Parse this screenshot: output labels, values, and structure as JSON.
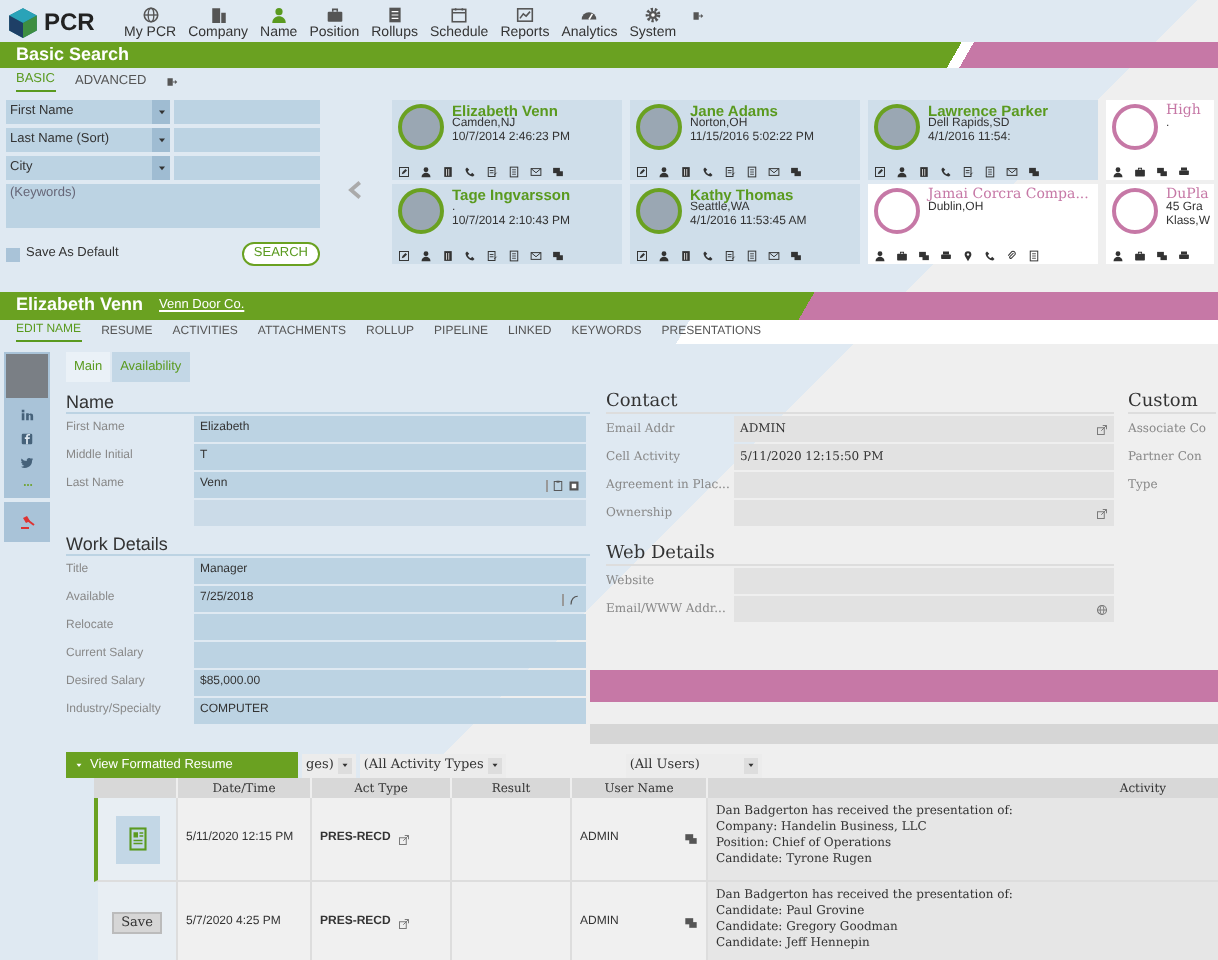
{
  "nav": {
    "logo": "PCR",
    "items": [
      {
        "label": "My PCR",
        "selected": false
      },
      {
        "label": "Company",
        "selected": false
      },
      {
        "label": "Name",
        "selected": true
      },
      {
        "label": "Position",
        "selected": false
      },
      {
        "label": "Rollups",
        "selected": false
      },
      {
        "label": "Schedule",
        "selected": false
      },
      {
        "label": "Reports",
        "selected": false
      },
      {
        "label": "Analytics",
        "selected": false
      },
      {
        "label": "System",
        "selected": false
      }
    ]
  },
  "search": {
    "title": "Basic Search",
    "tabs": [
      {
        "label": "BASIC",
        "selected": true
      },
      {
        "label": "ADVANCED",
        "selected": false
      }
    ],
    "fields": [
      {
        "label": "First Name"
      },
      {
        "label": "Last Name (Sort)"
      },
      {
        "label": "City"
      }
    ],
    "keywords_placeholder": "(Keywords)",
    "save_default": {
      "label": "Save As Default",
      "checked": false
    },
    "button": "SEARCH"
  },
  "results": [
    {
      "kind": "person",
      "name": "Elizabeth Venn",
      "line1": "Camden,NJ",
      "line2": "10/7/2014 2:46:23 PM"
    },
    {
      "kind": "person",
      "name": "Jane Adams",
      "line1": "Norton,OH",
      "line2": "11/15/2016 5:02:22 PM"
    },
    {
      "kind": "person",
      "name": "Lawrence Parker",
      "line1": "Dell Rapids,SD",
      "line2": "4/1/2016 11:54:"
    },
    {
      "kind": "company",
      "name": "High",
      "line1": "."
    },
    {
      "kind": "person",
      "name": "Tage Ingvarsson",
      "line1": ".",
      "line2": "10/7/2014 2:10:43 PM"
    },
    {
      "kind": "person",
      "name": "Kathy Thomas",
      "line1": "Seattle,WA",
      "line2": "4/1/2016 11:53:45 AM"
    },
    {
      "kind": "company",
      "name": "Jamai Corcra Compa...",
      "line2": "Dublin,OH"
    },
    {
      "kind": "company",
      "name": "DuPla",
      "line1": "45 Gra",
      "line2": "Klass,W"
    }
  ],
  "record": {
    "name": "Elizabeth Venn",
    "company": "Venn Door Co.",
    "tabs": [
      {
        "label": "EDIT NAME",
        "selected": true
      },
      {
        "label": "RESUME",
        "selected": false
      },
      {
        "label": "ACTIVITIES",
        "selected": false
      },
      {
        "label": "ATTACHMENTS",
        "selected": false
      },
      {
        "label": "ROLLUP",
        "selected": false
      },
      {
        "label": "PIPELINE",
        "selected": false
      },
      {
        "label": "LINKED",
        "selected": false
      },
      {
        "label": "KEYWORDS",
        "selected": false
      },
      {
        "label": "PRESENTATIONS",
        "selected": false
      }
    ],
    "subtabs": [
      {
        "label": "Main",
        "selected": true
      },
      {
        "label": "Availability",
        "selected": false
      }
    ],
    "name_section": {
      "title": "Name",
      "fields": [
        {
          "label": "First Name",
          "value": "Elizabeth"
        },
        {
          "label": "Middle Initial",
          "value": "T"
        },
        {
          "label": "Last Name",
          "value": "Venn",
          "kind": "tools"
        },
        {
          "kind": "blank"
        }
      ]
    },
    "work_section": {
      "title": "Work Details",
      "fields": [
        {
          "label": "Title",
          "value": "Manager"
        },
        {
          "label": "Available",
          "value": "7/25/2018",
          "kind": "date"
        },
        {
          "label": "Relocate"
        },
        {
          "label": "Current Salary"
        },
        {
          "label": "Desired Salary",
          "value": "$85,000.00"
        },
        {
          "label": "Industry/Specialty",
          "value": "COMPUTER"
        }
      ]
    },
    "contact_section": {
      "title": "Contact",
      "fields": [
        {
          "label": "Email Addr",
          "value": "ADMIN",
          "kind": "link"
        },
        {
          "label": "Cell Activity",
          "value": "5/11/2020 12:15:50 PM"
        },
        {
          "label": "Agreement in Plac..."
        },
        {
          "label": "Ownership",
          "kind": "link"
        }
      ]
    },
    "web_section": {
      "title": "Web Details",
      "fields": [
        {
          "label": "Website"
        },
        {
          "label": "Email/WWW Addr...",
          "kind": "globe"
        }
      ]
    },
    "custom_section": {
      "title": "Custom",
      "fields": [
        {
          "label": "Associate Co"
        },
        {
          "label": "Partner Con"
        },
        {
          "label": "Type"
        }
      ]
    }
  },
  "activities": {
    "button": "View Formatted Resume",
    "filters": [
      "ges)",
      "(All Activity Types",
      "(All Users)"
    ],
    "columns": [
      "Date/Time",
      "Act Type",
      "Result",
      "User Name",
      "Activity"
    ],
    "rows": [
      {
        "selected": true,
        "action": {
          "kind": "icon"
        },
        "date": "5/11/2020 12:15 PM",
        "type": "PRES-RECD",
        "user": "ADMIN",
        "activity": "Dan Badgerton has received the presentation of:\nCompany: Handelin Business, LLC\nPosition: Chief of Operations\nCandidate: Tyrone Rugen"
      },
      {
        "selected": false,
        "action": {
          "kind": "button",
          "label": "Save"
        },
        "date": "5/7/2020 4:25 PM",
        "type": "PRES-RECD",
        "user": "ADMIN",
        "activity": "Dan Badgerton has received the presentation of:\nCandidate: Paul Grovine\nCandidate: Gregory Goodman\nCandidate: Jeff Hennepin"
      }
    ]
  }
}
